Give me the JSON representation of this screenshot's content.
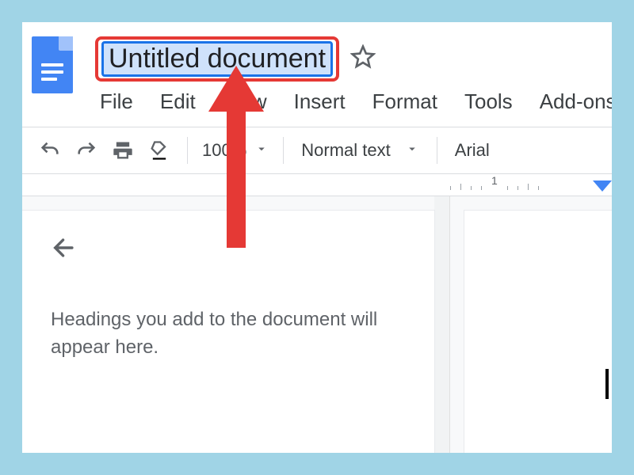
{
  "app": {
    "title": "Untitled document"
  },
  "menu": {
    "file": "File",
    "edit": "Edit",
    "view": "View",
    "insert": "Insert",
    "format": "Format",
    "tools": "Tools",
    "addons": "Add-ons"
  },
  "toolbar": {
    "zoom": "100%",
    "paragraph_style": "Normal text",
    "font": "Arial"
  },
  "ruler": {
    "mark_1": "1"
  },
  "outline": {
    "empty_message": "Headings you add to the document will appear here."
  }
}
